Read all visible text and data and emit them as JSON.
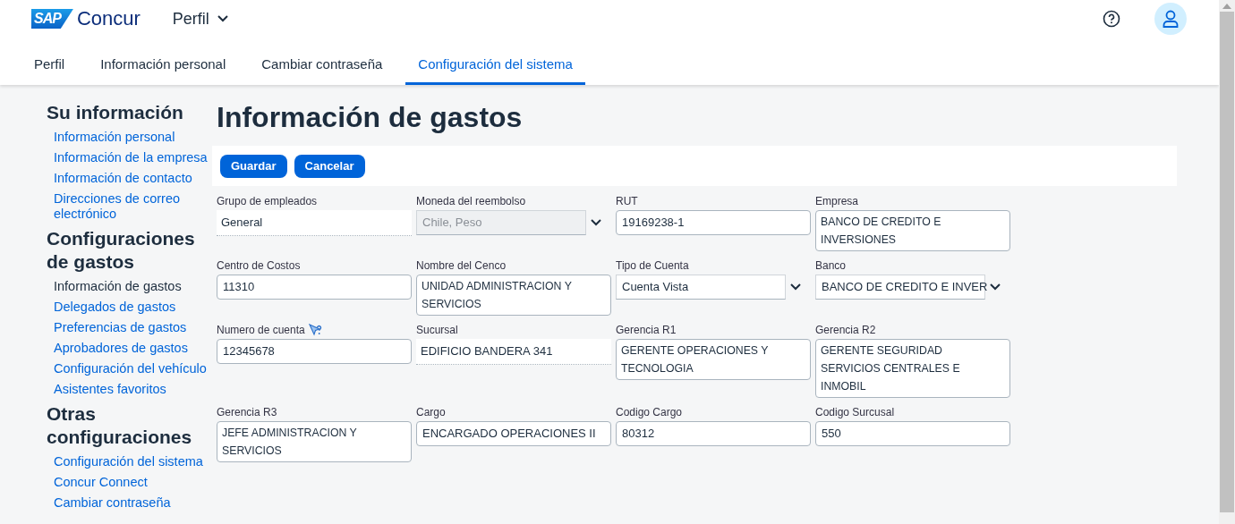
{
  "header": {
    "logo": {
      "badge": "SAP",
      "name": "Concur"
    },
    "menu": "Perfil"
  },
  "tabs": [
    {
      "label": "Perfil",
      "selected": false
    },
    {
      "label": "Información personal",
      "selected": false
    },
    {
      "label": "Cambiar contraseña",
      "selected": false
    },
    {
      "label": "Configuración del sistema",
      "selected": true
    }
  ],
  "sidebar": {
    "sections": [
      {
        "title": "Su información",
        "items": [
          {
            "label": "Información personal",
            "selected": false
          },
          {
            "label": "Información de la empresa",
            "selected": false
          },
          {
            "label": "Información de contacto",
            "selected": false
          },
          {
            "label": "Direcciones de correo electrónico",
            "selected": false
          }
        ]
      },
      {
        "title": "Configuraciones de gastos",
        "items": [
          {
            "label": "Información de gastos",
            "selected": true
          },
          {
            "label": "Delegados de gastos",
            "selected": false
          },
          {
            "label": "Preferencias de gastos",
            "selected": false
          },
          {
            "label": "Aprobadores de gastos",
            "selected": false
          },
          {
            "label": "Configuración del vehículo",
            "selected": false
          },
          {
            "label": "Asistentes favoritos",
            "selected": false
          }
        ]
      },
      {
        "title": "Otras configuraciones",
        "items": [
          {
            "label": "Configuración del sistema",
            "selected": false
          },
          {
            "label": "Concur Connect",
            "selected": false
          },
          {
            "label": "Cambiar contraseña",
            "selected": false
          }
        ]
      }
    ]
  },
  "page_title": "Información de gastos",
  "buttons": [
    "Guardar",
    "Cancelar"
  ],
  "fields": [
    {
      "label": "Grupo de empleados",
      "kind": "readonly",
      "value": "General"
    },
    {
      "label": "Moneda del reembolso",
      "kind": "select",
      "value": "Chile, Peso",
      "disabled": true
    },
    {
      "label": "RUT",
      "kind": "text",
      "value": "19169238-1"
    },
    {
      "label": "Empresa",
      "kind": "multiline",
      "value": "BANCO DE CREDITO E INVERSIONES"
    },
    {
      "label": "Centro de Costos",
      "kind": "text",
      "value": "11310"
    },
    {
      "label": "Nombre del Cenco",
      "kind": "multiline",
      "value": "UNIDAD ADMINISTRACION Y SERVICIOS"
    },
    {
      "label": "Tipo de Cuenta",
      "kind": "select",
      "value": "Cuenta Vista",
      "disabled": false
    },
    {
      "label": "Banco",
      "kind": "select",
      "value": "BANCO DE CREDITO E INVER",
      "disabled": false
    },
    {
      "label": "Numero de cuenta",
      "kind": "text",
      "value": "12345678",
      "help": true
    },
    {
      "label": "Sucursal",
      "kind": "readonly",
      "value": "EDIFICIO BANDERA 341"
    },
    {
      "label": "Gerencia R1",
      "kind": "multiline",
      "value": "GERENTE OPERACIONES Y TECNOLOGIA"
    },
    {
      "label": "Gerencia R2",
      "kind": "multiline",
      "value": "GERENTE SEGURIDAD SERVICIOS CENTRALES E INMOBIL"
    },
    {
      "label": "Gerencia R3",
      "kind": "multiline",
      "value": "JEFE ADMINISTRACION Y SERVICIOS"
    },
    {
      "label": "Cargo",
      "kind": "text",
      "value": "ENCARGADO OPERACIONES II"
    },
    {
      "label": "Codigo Cargo",
      "kind": "text",
      "value": "80312"
    },
    {
      "label": "Codigo Surcusal",
      "kind": "text",
      "value": "550"
    }
  ]
}
